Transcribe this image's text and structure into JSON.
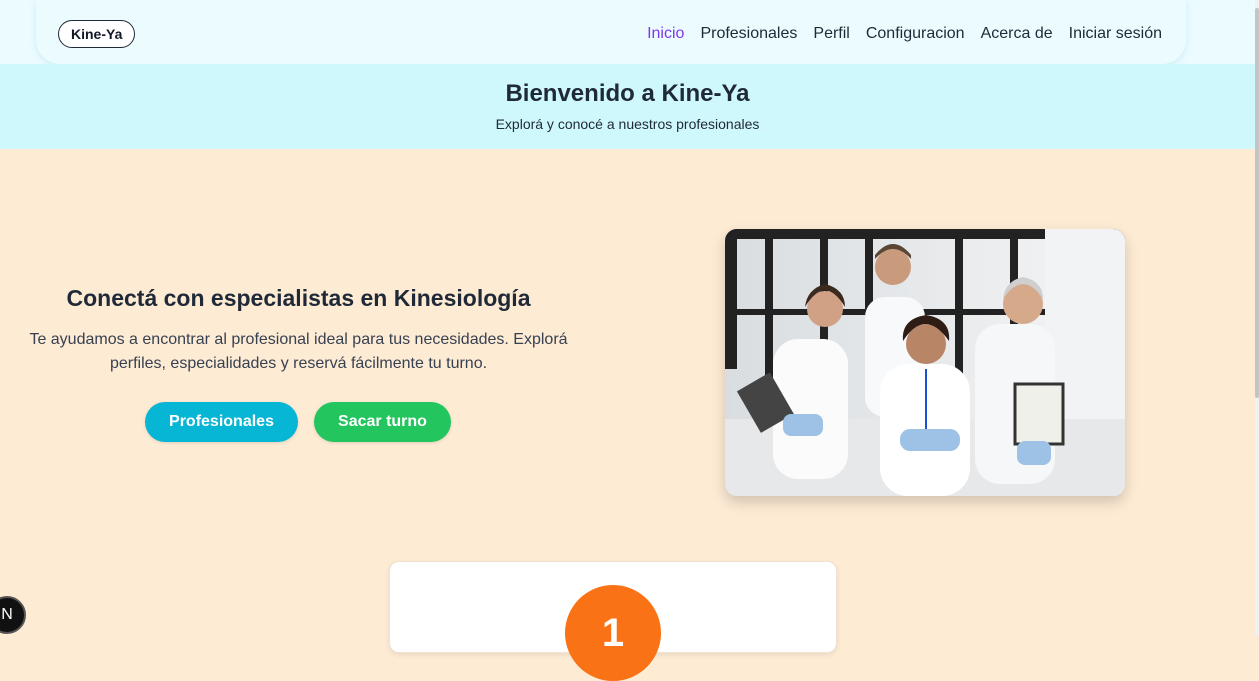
{
  "brand": {
    "logo": "Kine-Ya"
  },
  "nav": {
    "items": [
      {
        "label": "Inicio"
      },
      {
        "label": "Profesionales"
      },
      {
        "label": "Perfil"
      },
      {
        "label": "Configuracion"
      },
      {
        "label": "Acerca de"
      },
      {
        "label": "Iniciar sesión"
      }
    ]
  },
  "welcome": {
    "title": "Bienvenido a Kine-Ya",
    "subtitle": "Explorá y conocé a nuestros profesionales"
  },
  "hero": {
    "title": "Conectá con especialistas en Kinesiología",
    "description": "Te ayudamos a encontrar al profesional ideal para tus necesidades. Explorá perfiles, especialidades y reservá fácilmente tu turno.",
    "primary_button": "Profesionales",
    "secondary_button": "Sacar turno",
    "image": "team-of-doctors-photo"
  },
  "steps": {
    "first_number": "1"
  },
  "dev_badge": {
    "letter": "N"
  },
  "colors": {
    "accent_active": "#7c3aed",
    "primary_button": "#06b6d4",
    "secondary_button": "#22c55e",
    "step_circle": "#f97316",
    "welcome_band": "#cff8fc",
    "page_background": "#fdebd4"
  }
}
